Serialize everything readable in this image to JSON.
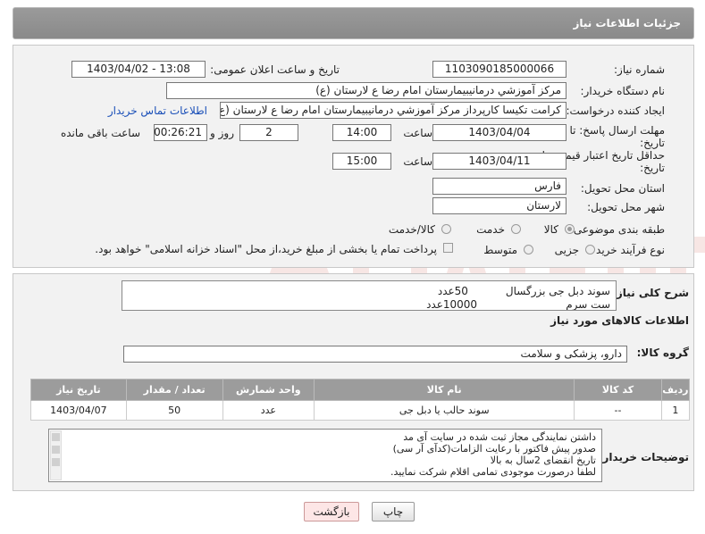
{
  "header": {
    "title": "جزئیات اطلاعات نیاز"
  },
  "form": {
    "need_number_label": "شماره نیاز:",
    "need_number": "1103090185000066",
    "announce_label": "تاریخ و ساعت اعلان عمومی:",
    "announce_value": "1403/04/02 - 13:08",
    "buyer_org_label": "نام دستگاه خریدار:",
    "buyer_org": "مرکز آموزشي درمانيبيمارستان امام رضا  ع  لارستان (ع)",
    "creator_label": "ایجاد کننده درخواست:",
    "creator": "کرامت تکیسا کارپرداز مرکز آموزشي درمانيبيمارستان امام رضا  ع  لارستان (ع)",
    "contact_link": "اطلاعات تماس خریدار",
    "deadline_label_1": "مهلت ارسال پاسخ: تا",
    "deadline_label_2": "تاریخ:",
    "deadline_date": "1403/04/04",
    "time_word": "ساعت",
    "deadline_time": "14:00",
    "days_value": "2",
    "days_word": "روز و",
    "remaining_time": "00:26:21",
    "remaining_label": "ساعت باقی مانده",
    "validity_label_1": "حداقل تاریخ اعتبار قیمت: تا",
    "validity_label_2": "تاریخ:",
    "validity_date": "1403/04/11",
    "validity_time": "15:00",
    "province_label": "استان محل تحویل:",
    "province": "فارس",
    "city_label": "شهر محل تحویل:",
    "city": "لارستان",
    "category_label": "طبقه بندی موضوعی:",
    "category_options": [
      "کالا",
      "خدمت",
      "کالا/خدمت"
    ],
    "process_label": "نوع فرآیند خرید :",
    "process_options": [
      "جزیی",
      "متوسط"
    ],
    "payment_note": "پرداخت تمام یا بخشی از مبلغ خرید،از محل \"اسناد خزانه اسلامی\" خواهد بود."
  },
  "details": {
    "summary_label": "شرح کلی نیاز:",
    "summary_line1": "سوند دبل جی بزرگسال           50عدد",
    "summary_line2": "ست سرم                          10000عدد",
    "goods_info_title": "اطلاعات کالاهای مورد نیاز",
    "goods_group_label": "گروه کالا:",
    "goods_group": "دارو، پزشکی و سلامت",
    "table": {
      "headers": [
        "ردیف",
        "کد کالا",
        "نام کالا",
        "واحد شمارش",
        "تعداد / مقدار",
        "تاریخ نیاز"
      ],
      "rows": [
        [
          "1",
          "--",
          "سوند حالب یا دبل جی",
          "عدد",
          "50",
          "1403/04/07"
        ]
      ]
    },
    "buyer_notes_label": "توضیحات خریدار:",
    "buyer_notes": [
      "داشتن نمایندگی مجاز ثبت شده در سایت آی مد",
      "صدور پیش فاکتور با رعایت الزامات(کدآی آر سی)",
      "تاریخ انقضای 2سال به بالا",
      "لطفا درصورت موجودی تمامی اقلام شرکت نمایید."
    ]
  },
  "buttons": {
    "print": "چاپ",
    "back": "بازگشت"
  },
  "colors": {
    "header_bg": "#8f8f8f",
    "panel_bg": "#f2f2f2",
    "back_button_bg": "#fde6e6"
  }
}
